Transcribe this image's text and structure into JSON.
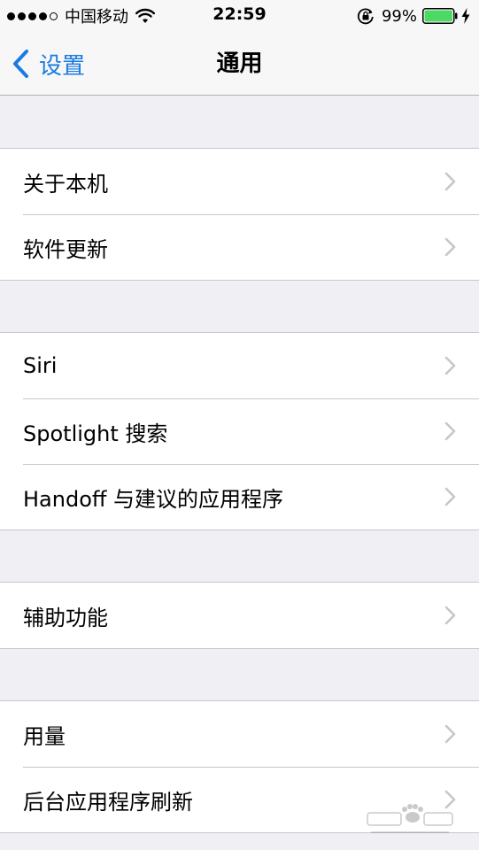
{
  "status_bar": {
    "carrier": "中国移动",
    "time": "22:59",
    "battery_percent": "99%",
    "signal_bars_filled": 4,
    "signal_bars_total": 5,
    "icons": [
      "wifi-icon",
      "rotation-lock-icon",
      "battery-icon",
      "charging-bolt-icon"
    ]
  },
  "nav": {
    "back_label": "设置",
    "title": "通用"
  },
  "groups": [
    {
      "items": [
        {
          "label": "关于本机"
        },
        {
          "label": "软件更新"
        }
      ]
    },
    {
      "items": [
        {
          "label": "Siri"
        },
        {
          "label": "Spotlight 搜索"
        },
        {
          "label": "Handoff 与建议的应用程序"
        }
      ]
    },
    {
      "items": [
        {
          "label": "辅助功能"
        }
      ]
    },
    {
      "items": [
        {
          "label": "用量"
        },
        {
          "label": "后台应用程序刷新"
        }
      ]
    }
  ],
  "colors": {
    "accent": "#1a7ce0",
    "background": "#efeff4",
    "cell_background": "#ffffff",
    "separator": "#c8c7cc",
    "chevron": "#c7c7cc",
    "battery_fill": "#4cd964"
  },
  "watermark": {
    "icon": "baidu-jingyan-watermark-icon"
  }
}
